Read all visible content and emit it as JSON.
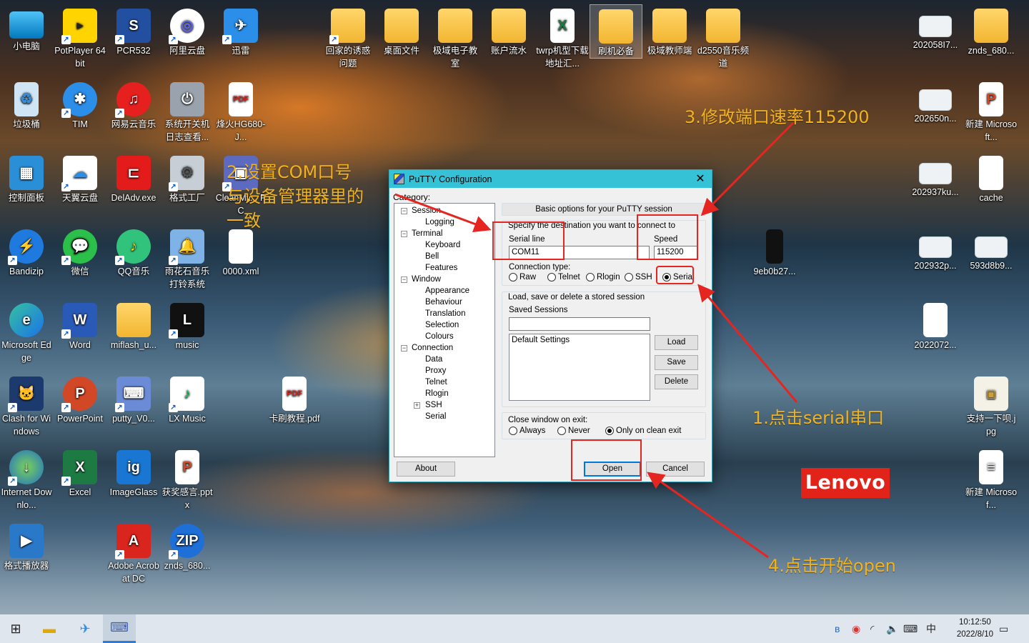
{
  "desktop_icons": {
    "col1": [
      "小电脑",
      "垃圾桶",
      "控制面板",
      "Bandizip",
      "Microsoft Edge",
      "Clash for Windows",
      "Internet Downlo...",
      "格式播放器"
    ],
    "col2": [
      "PotPlayer 64 bit",
      "TIM",
      "天翼云盘",
      "微信",
      "Word",
      "PowerPoint",
      "Excel"
    ],
    "col3": [
      "PCR532",
      "网易云音乐",
      "DelAdv.exe",
      "QQ音乐",
      "miflash_u...",
      "putty_V0...",
      "ImageGlass",
      "Adobe Acrobat DC"
    ],
    "col4": [
      "阿里云盘",
      "系统开关机日志查看...",
      "格式工厂",
      "雨花石音乐打铃系统",
      "music",
      "LX Music",
      "获奖感言.pptx",
      "znds_680..."
    ],
    "col5": [
      "迅雷",
      "烽火HG680-J...",
      "CleanMy... PC",
      "0000.xml"
    ],
    "misc": [
      "卡刷教程.pdf"
    ],
    "top_row": [
      "回家的诱惑问题",
      "桌面文件",
      "极域电子教室",
      "账户流水",
      "twrp机型下载地址汇...",
      "刷机必备",
      "极域教师端",
      "d2550音乐频道"
    ],
    "right_col1": [
      "202058I7...",
      "202650n...",
      "202937ku...",
      "202932p...",
      "2022072...",
      "9eb0b27..."
    ],
    "right_col2": [
      "znds_680...",
      "新建 Microsoft...",
      "cache",
      "593d8b9...",
      "支持一下呗.jpg",
      "新建 Microsof..."
    ]
  },
  "putty": {
    "title": "PuTTY Configuration",
    "close": "✕",
    "category_label": "Category:",
    "tree": [
      {
        "label": "Session",
        "level": 0,
        "box": "−"
      },
      {
        "label": "Logging",
        "level": 1
      },
      {
        "label": "Terminal",
        "level": 0,
        "box": "−"
      },
      {
        "label": "Keyboard",
        "level": 1
      },
      {
        "label": "Bell",
        "level": 1
      },
      {
        "label": "Features",
        "level": 1
      },
      {
        "label": "Window",
        "level": 0,
        "box": "−"
      },
      {
        "label": "Appearance",
        "level": 1
      },
      {
        "label": "Behaviour",
        "level": 1
      },
      {
        "label": "Translation",
        "level": 1
      },
      {
        "label": "Selection",
        "level": 1
      },
      {
        "label": "Colours",
        "level": 1
      },
      {
        "label": "Connection",
        "level": 0,
        "box": "−"
      },
      {
        "label": "Data",
        "level": 1
      },
      {
        "label": "Proxy",
        "level": 1
      },
      {
        "label": "Telnet",
        "level": 1
      },
      {
        "label": "Rlogin",
        "level": 1
      },
      {
        "label": "SSH",
        "level": 1,
        "box": "+"
      },
      {
        "label": "Serial",
        "level": 1
      }
    ],
    "header_banner": "Basic options for your PuTTY session",
    "destination_label": "Specify the destination you want to connect to",
    "serial_line_label": "Serial line",
    "serial_line_value": "COM11",
    "speed_label": "Speed",
    "speed_value": "115200",
    "conn_type_label": "Connection type:",
    "conn_types": [
      "Raw",
      "Telnet",
      "Rlogin",
      "SSH",
      "Serial"
    ],
    "conn_selected": "Serial",
    "sessions_group": "Load, save or delete a stored session",
    "saved_sessions_label": "Saved Sessions",
    "saved_sessions_value": "",
    "session_list": [
      "Default Settings"
    ],
    "load": "Load",
    "save": "Save",
    "delete": "Delete",
    "close_on_exit_label": "Close window on exit:",
    "close_options": [
      "Always",
      "Never",
      "Only on clean exit"
    ],
    "close_selected": "Only on clean exit",
    "about": "About",
    "open": "Open",
    "cancel": "Cancel"
  },
  "annotations": {
    "step1": "1.点击serial串口",
    "step2_line1": "2.设置COM口号",
    "step2_line2": "与设备管理器里的",
    "step2_line3": "一致",
    "step3": "3.修改端口速率115200",
    "step4": "4.点击开始open",
    "annotation_color": "#f2b21c",
    "highlight_color": "#e52620"
  },
  "brand": "Lenovo",
  "taskbar": {
    "time": "10:12:50",
    "date": "2022/8/10",
    "ime": "中"
  }
}
